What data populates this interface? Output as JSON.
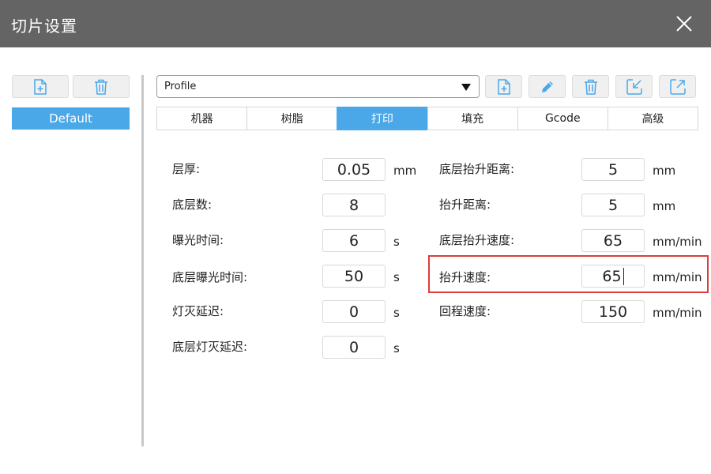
{
  "window": {
    "title": "切片设置"
  },
  "presets": {
    "items": [
      "Default"
    ],
    "selected": "Default"
  },
  "profile": {
    "value": "Profile"
  },
  "tabs": [
    {
      "label": "机器",
      "active": false
    },
    {
      "label": "树脂",
      "active": false
    },
    {
      "label": "打印",
      "active": true
    },
    {
      "label": "填充",
      "active": false
    },
    {
      "label": "Gcode",
      "active": false
    },
    {
      "label": "高级",
      "active": false
    }
  ],
  "left_fields": [
    {
      "label": "层厚:",
      "value": "0.05",
      "unit": "mm"
    },
    {
      "label": "底层数:",
      "value": "8",
      "unit": ""
    },
    {
      "label": "曝光时间:",
      "value": "6",
      "unit": "s"
    },
    {
      "label": "底层曝光时间:",
      "value": "50",
      "unit": "s"
    },
    {
      "label": "灯灭延迟:",
      "value": "0",
      "unit": "s"
    },
    {
      "label": "底层灯灭延迟:",
      "value": "0",
      "unit": "s"
    }
  ],
  "right_fields": [
    {
      "label": "底层抬升距离:",
      "value": "5",
      "unit": "mm"
    },
    {
      "label": "抬升距离:",
      "value": "5",
      "unit": "mm"
    },
    {
      "label": "底层抬升速度:",
      "value": "65",
      "unit": "mm/min"
    },
    {
      "label": "抬升速度:",
      "value": "65",
      "unit": "mm/min",
      "focused": true
    },
    {
      "label": "回程速度:",
      "value": "150",
      "unit": "mm/min"
    }
  ],
  "colors": {
    "accent": "#4aa8e8",
    "titlebar": "#646464",
    "highlight": "#e03c3c"
  },
  "icons": {
    "new": "file-plus-icon",
    "delete": "trash-icon",
    "edit": "pencil-icon",
    "import": "import-icon",
    "export": "export-icon",
    "close": "close-icon",
    "dropdown": "caret-down-icon"
  }
}
